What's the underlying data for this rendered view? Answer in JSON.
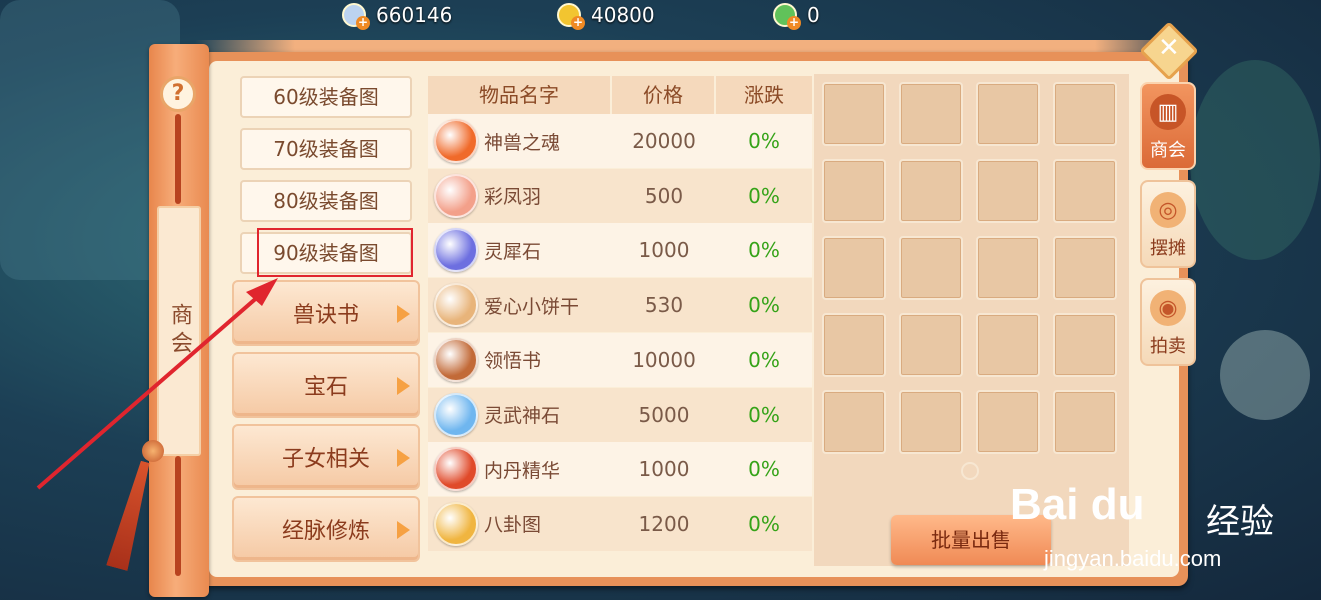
{
  "currency": [
    {
      "icon": "silver-coin-icon",
      "value": "660146",
      "color": "#bcd3f0"
    },
    {
      "icon": "gold-coin-icon",
      "value": "40800",
      "color": "#f2c530"
    },
    {
      "icon": "jade-coin-icon",
      "value": "0",
      "color": "#61c25a"
    }
  ],
  "scroll": {
    "label": "商会",
    "help": "?"
  },
  "categories": {
    "sub_items": [
      "60级装备图",
      "70级装备图",
      "80级装备图",
      "90级装备图"
    ],
    "buttons": [
      "兽诀书",
      "宝石",
      "子女相关",
      "经脉修炼"
    ]
  },
  "table": {
    "headers": [
      "物品名字",
      "价格",
      "涨跌"
    ],
    "rows": [
      {
        "name": "神兽之魂",
        "price": "20000",
        "change": "0%",
        "icon": "beast-soul-icon",
        "color": "#f06a2a"
      },
      {
        "name": "彩凤羽",
        "price": "500",
        "change": "0%",
        "icon": "phoenix-feather-icon",
        "color": "#f3a08a"
      },
      {
        "name": "灵犀石",
        "price": "1000",
        "change": "0%",
        "icon": "crystal-stone-icon",
        "color": "#6d6fe0"
      },
      {
        "name": "爱心小饼干",
        "price": "530",
        "change": "0%",
        "icon": "heart-cookie-icon",
        "color": "#e8b47a"
      },
      {
        "name": "领悟书",
        "price": "10000",
        "change": "0%",
        "icon": "book-icon",
        "color": "#c26a38"
      },
      {
        "name": "灵武神石",
        "price": "5000",
        "change": "0%",
        "icon": "spirit-stone-icon",
        "color": "#6fb6ef"
      },
      {
        "name": "内丹精华",
        "price": "1000",
        "change": "0%",
        "icon": "elixir-icon",
        "color": "#e04a2a"
      },
      {
        "name": "八卦图",
        "price": "1200",
        "change": "0%",
        "icon": "bagua-icon",
        "color": "#f0b540"
      }
    ]
  },
  "grid": {
    "rows": 5,
    "cols": 4
  },
  "bulk_sell": "批量出售",
  "right_tabs": [
    {
      "label": "商会",
      "icon": "chamber-icon",
      "active": true
    },
    {
      "label": "摆摊",
      "icon": "stall-icon",
      "active": false
    },
    {
      "label": "拍卖",
      "icon": "auction-icon",
      "active": false
    }
  ],
  "close": "✕",
  "watermark": {
    "logo": "Bai du",
    "text": "经验",
    "url": "jingyan.baidu.com"
  }
}
